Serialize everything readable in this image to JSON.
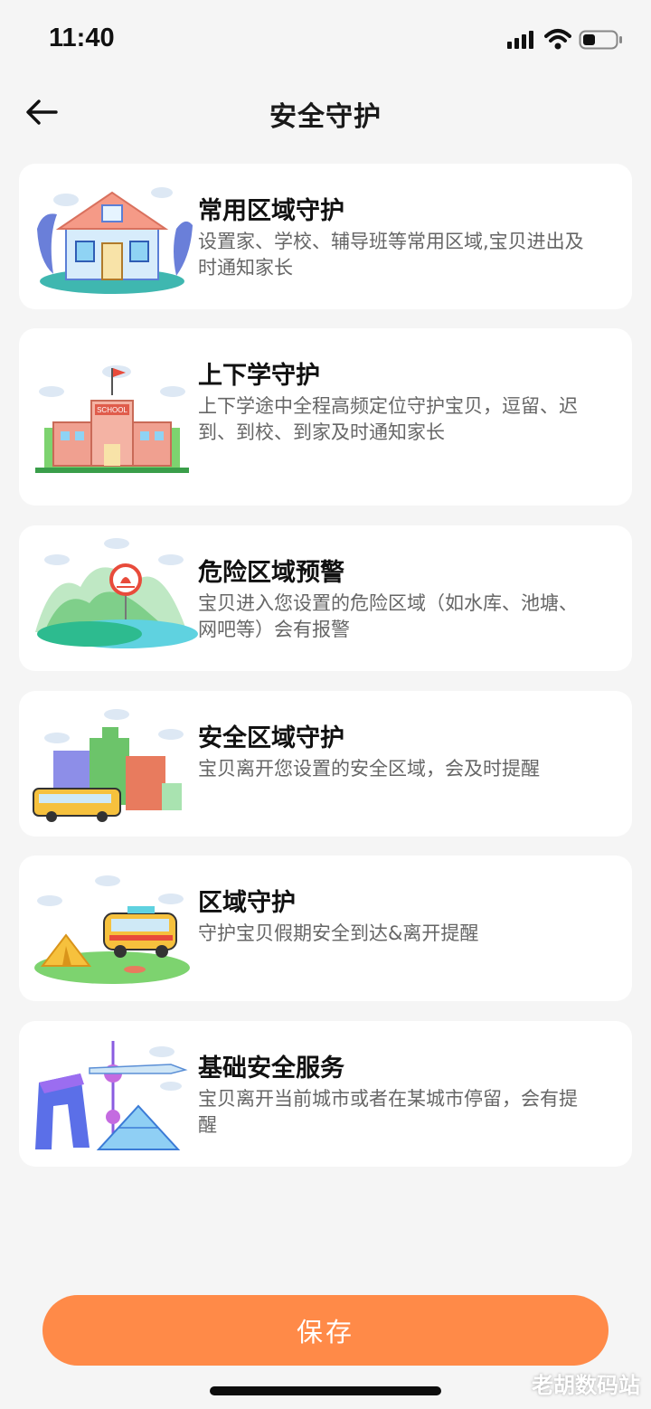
{
  "status_bar": {
    "time": "11:40",
    "icons": [
      "signal-icon",
      "wifi-icon",
      "battery-icon"
    ]
  },
  "header": {
    "title": "安全守护",
    "back_icon": "back-arrow-icon"
  },
  "cards": [
    {
      "title": "常用区域守护",
      "desc": "设置家、学校、辅导班等常用区域,宝贝进出及时通知家长",
      "illustration": "house-illustration"
    },
    {
      "title": "上下学守护",
      "desc": "上下学途中全程高频定位守护宝贝，逗留、迟到、到校、到家及时通知家长",
      "illustration": "school-illustration",
      "school_sign": "SCHOOL"
    },
    {
      "title": "危险区域预警",
      "desc": "宝贝进入您设置的危险区域（如水库、池塘、网吧等）会有报警",
      "illustration": "lake-warning-illustration"
    },
    {
      "title": "安全区域守护",
      "desc": "宝贝离开您设置的安全区域，会及时提醒",
      "illustration": "city-bus-illustration"
    },
    {
      "title": "区域守护",
      "desc": "守护宝贝假期安全到达&离开提醒",
      "illustration": "camping-van-illustration"
    },
    {
      "title": "基础安全服务",
      "desc": "宝贝离开当前城市或者在某城市停留，会有提醒",
      "illustration": "city-landmarks-illustration"
    }
  ],
  "save_button": "保存",
  "watermark": "老胡数码站",
  "colors": {
    "accent": "#ff8a48",
    "background": "#f5f5f5",
    "card": "#ffffff",
    "title_text": "#111111",
    "desc_text": "#666666"
  }
}
